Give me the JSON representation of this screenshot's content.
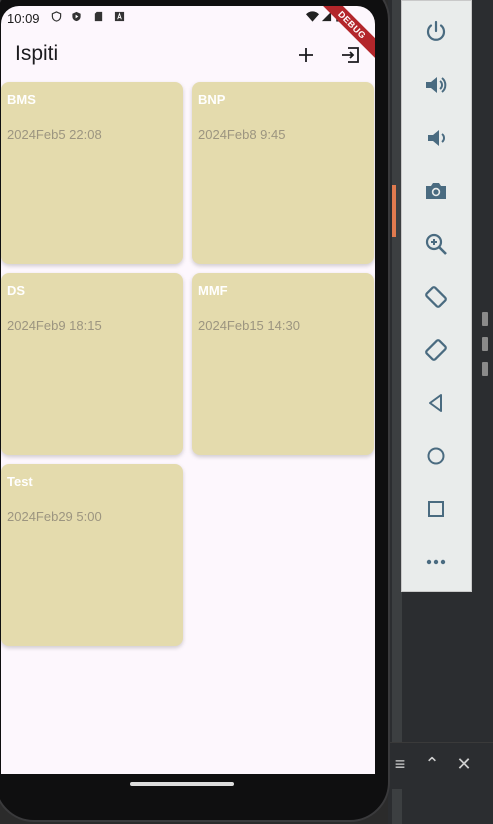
{
  "status_bar": {
    "time": "10:09",
    "icons": [
      "shield-icon",
      "play-protect-icon",
      "sd-card-icon",
      "a-icon"
    ],
    "right_icons": [
      "wifi-icon",
      "signal-icon",
      "battery-icon"
    ]
  },
  "app_bar": {
    "title": "Ispiti",
    "actions": [
      "add-icon",
      "logout-icon"
    ]
  },
  "debug_banner": "DEBUG",
  "exams": [
    {
      "name": "BMS",
      "date": "2024Feb5 22:08"
    },
    {
      "name": "BNP",
      "date": "2024Feb8 9:45"
    },
    {
      "name": "DS",
      "date": "2024Feb9 18:15"
    },
    {
      "name": "MMF",
      "date": "2024Feb15 14:30"
    },
    {
      "name": "Test",
      "date": "2024Feb29 5:00"
    }
  ],
  "colors": {
    "card": "#e4dbad",
    "background": "#fdf7fd",
    "card_text": "#ffffff",
    "date_text": "#9c9580"
  },
  "emulator_controls": [
    "power-icon",
    "volume-up-icon",
    "volume-down-icon",
    "camera-icon",
    "zoom-icon",
    "rotate-left-icon",
    "rotate-right-icon",
    "back-icon",
    "home-icon",
    "overview-icon",
    "more-icon"
  ]
}
